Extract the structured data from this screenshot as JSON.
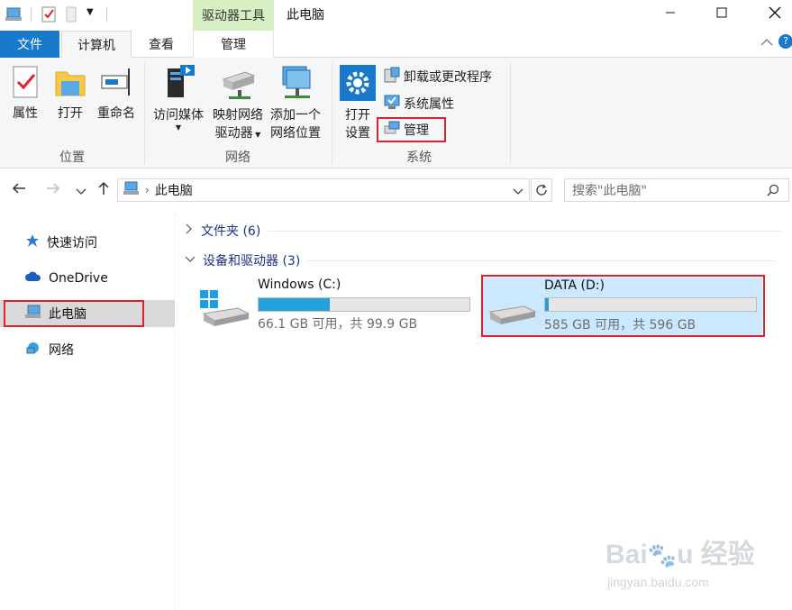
{
  "window": {
    "title": "此电脑",
    "contextual_group": "驱动器工具"
  },
  "tabs": [
    {
      "label": "文件"
    },
    {
      "label": "计算机"
    },
    {
      "label": "查看"
    },
    {
      "label": "管理"
    }
  ],
  "ribbon": {
    "location": {
      "group_label": "位置",
      "properties": "属性",
      "open": "打开",
      "rename": "重命名"
    },
    "network": {
      "group_label": "网络",
      "access_media": "访问媒体",
      "map_drive_line1": "映射网络",
      "map_drive_line2": "驱动器",
      "add_location_line1": "添加一个",
      "add_location_line2": "网络位置"
    },
    "system": {
      "group_label": "系统",
      "open_settings_line1": "打开",
      "open_settings_line2": "设置",
      "uninstall": "卸载或更改程序",
      "system_properties": "系统属性",
      "manage": "管理"
    }
  },
  "address": {
    "path": "此电脑",
    "search_placeholder": "搜索\"此电脑\""
  },
  "navpane": {
    "items": [
      {
        "label": "快速访问"
      },
      {
        "label": "OneDrive"
      },
      {
        "label": "此电脑"
      },
      {
        "label": "网络"
      }
    ]
  },
  "content": {
    "folders_section": "文件夹 (6)",
    "devices_section": "设备和驱动器 (3)",
    "drives": [
      {
        "name": "Windows (C:)",
        "info": "66.1 GB 可用，共 99.9 GB",
        "used_fraction": 0.338
      },
      {
        "name": "DATA (D:)",
        "info": "585 GB 可用，共 596 GB",
        "used_fraction": 0.018
      }
    ]
  },
  "colors": {
    "accent": "#1979ca",
    "bar_fill": "#26a0da",
    "highlight": "#e0202a",
    "selection": "#cce8ff"
  }
}
